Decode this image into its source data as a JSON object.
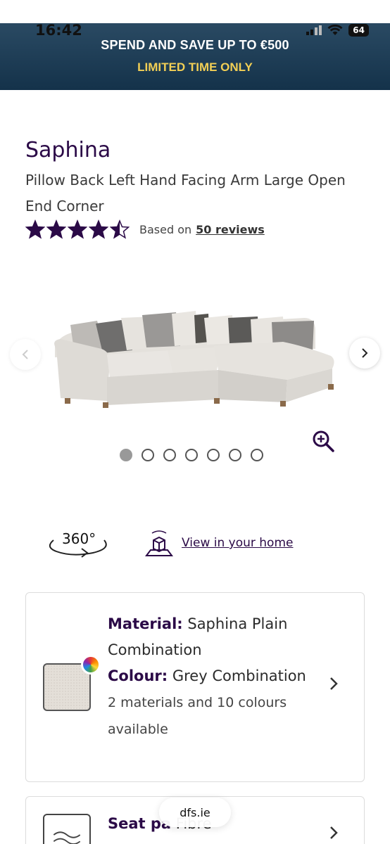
{
  "status_bar": {
    "time": "16:42",
    "battery": "64"
  },
  "promo": {
    "line1": "SPEND AND SAVE UP TO €500",
    "line2": "LIMITED TIME ONLY"
  },
  "product": {
    "title": "Saphina",
    "subtitle": "Pillow Back Left Hand Facing Arm Large Open End Corner",
    "rating": 4.5,
    "based_on": "Based on",
    "reviews_link": "50 reviews"
  },
  "carousel": {
    "slide_count": 7,
    "active_slide": 1
  },
  "view_options": {
    "label_360": "360°",
    "view_in_home": "View in your home"
  },
  "material_card": {
    "material_label": "Material:",
    "material_value": "Saphina Plain Combination",
    "colour_label": "Colour:",
    "colour_value": "Grey Combination",
    "availability": "2 materials and 10 colours available"
  },
  "seat_card": {
    "label": "Seat pa",
    "value": "Fibre"
  },
  "browser": {
    "url": "dfs.ie"
  },
  "colors": {
    "brand_purple": "#2b0a47",
    "promo_bg": "#14324a",
    "promo_accent": "#f2cf55"
  }
}
